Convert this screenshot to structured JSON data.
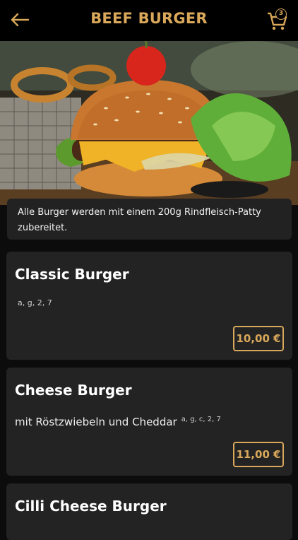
{
  "header": {
    "title": "BEEF BURGER",
    "back_icon": "arrow-left-icon",
    "cart_icon": "shopping-cart-icon",
    "cart_count": "3"
  },
  "colors": {
    "accent": "#d9a85a",
    "background": "#0c0c0c",
    "card": "#232323"
  },
  "info": {
    "text": "Alle Burger werden mit einem 200g Rindfleisch-Patty zubereitet."
  },
  "products": [
    {
      "name": "Classic Burger",
      "description": "",
      "allergens": "a, g, 2, 7",
      "price": "10,00 €"
    },
    {
      "name": "Cheese Burger",
      "description": "mit Röstzwiebeln und Cheddar",
      "allergens": "a, g, c, 2, 7",
      "price": "11,00 €"
    },
    {
      "name": "Cilli Cheese Burger"
    }
  ]
}
